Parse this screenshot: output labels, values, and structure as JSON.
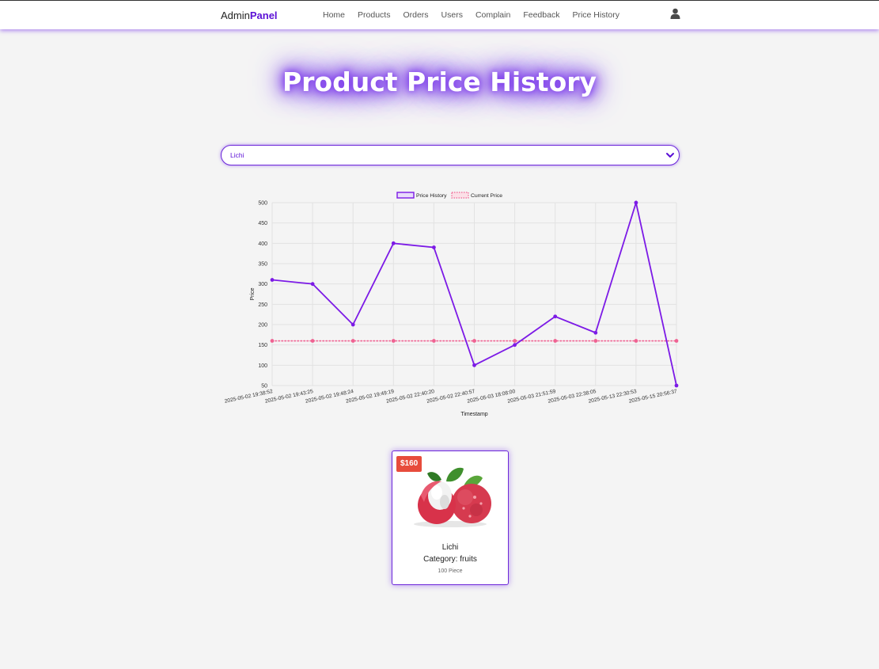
{
  "brand": {
    "prefix": "Admin",
    "highlight": "Panel"
  },
  "nav": {
    "items": [
      {
        "label": "Home"
      },
      {
        "label": "Products"
      },
      {
        "label": "Orders"
      },
      {
        "label": "Users"
      },
      {
        "label": "Complain"
      },
      {
        "label": "Feedback"
      },
      {
        "label": "Price History"
      }
    ],
    "user_icon": "user-icon"
  },
  "page": {
    "title": "Product Price History"
  },
  "product_select": {
    "selected": "Lichi"
  },
  "chart_data": {
    "type": "line",
    "x": [
      "2025-05-02 19:38:52",
      "2025-05-02 19:43:25",
      "2025-05-02 19:48:24",
      "2025-05-02 19:49:19",
      "2025-05-02 22:40:20",
      "2025-05-02 22:40:57",
      "2025-05-03 18:08:00",
      "2025-05-03 21:51:59",
      "2025-05-03 22:38:05",
      "2025-05-13 22:30:53",
      "2025-05-15 20:56:37"
    ],
    "series": [
      {
        "name": "Price History",
        "values": [
          310,
          300,
          200,
          400,
          390,
          100,
          150,
          220,
          180,
          500,
          50
        ],
        "color": "#7c1ae6"
      },
      {
        "name": "Current Price",
        "values": [
          160,
          160,
          160,
          160,
          160,
          160,
          160,
          160,
          160,
          160,
          160
        ],
        "color": "#f06292",
        "style": "dotted"
      }
    ],
    "xlabel": "Timestamp",
    "ylabel": "Price",
    "ylim": [
      50,
      500
    ],
    "yticks": [
      50,
      100,
      150,
      200,
      250,
      300,
      350,
      400,
      450,
      500
    ],
    "grid": true,
    "legend_position": "top"
  },
  "product_card": {
    "price": "$160",
    "name": "Lichi",
    "category": "Category: fruits",
    "unit": "100 Piece",
    "image": "lichi-fruit-image"
  },
  "colors": {
    "accent": "#6d28d9",
    "badge": "#e74c3c",
    "current_price": "#f06292"
  }
}
